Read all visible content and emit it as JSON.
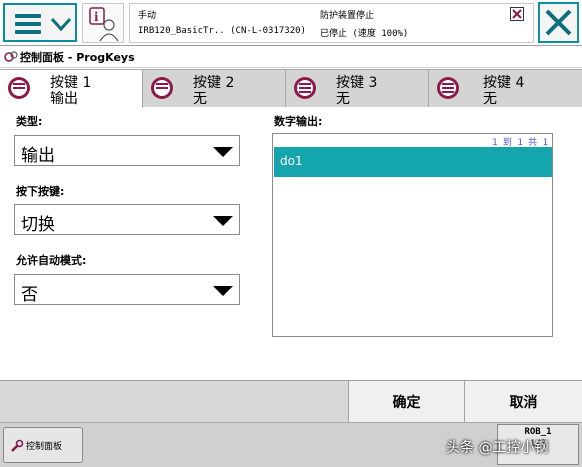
{
  "status": {
    "mode": "手动",
    "controller": "IRB120_BasicTr..  (CN-L-0317320)",
    "guard": "防护装置停止",
    "state": "已停止 (速度 100%)"
  },
  "title": "控制面板 - ProgKeys",
  "tabs": [
    {
      "key": "按键 1",
      "value": "输出"
    },
    {
      "key": "按键 2",
      "value": "无"
    },
    {
      "key": "按键 3",
      "value": "无"
    },
    {
      "key": "按键 4",
      "value": "无"
    }
  ],
  "form": {
    "type_label": "类型:",
    "type_value": "输出",
    "press_label": "按下按键:",
    "press_value": "切换",
    "auto_label": "允许自动模式:",
    "auto_value": "否",
    "do_label": "数字输出:",
    "do_count": "1 到 1 共 1",
    "do_items": [
      "do1"
    ]
  },
  "commands": {
    "ok": "确定",
    "cancel": "取消"
  },
  "taskbar": {
    "panel": "控制面板",
    "rob_label": "ROB_1",
    "rob_value": "1/3"
  },
  "watermark": "头条 @工控小钢",
  "colors": {
    "accent": "#0a8ea0",
    "selection": "#14a5ad",
    "tab_icon": "#8b1a4a"
  }
}
